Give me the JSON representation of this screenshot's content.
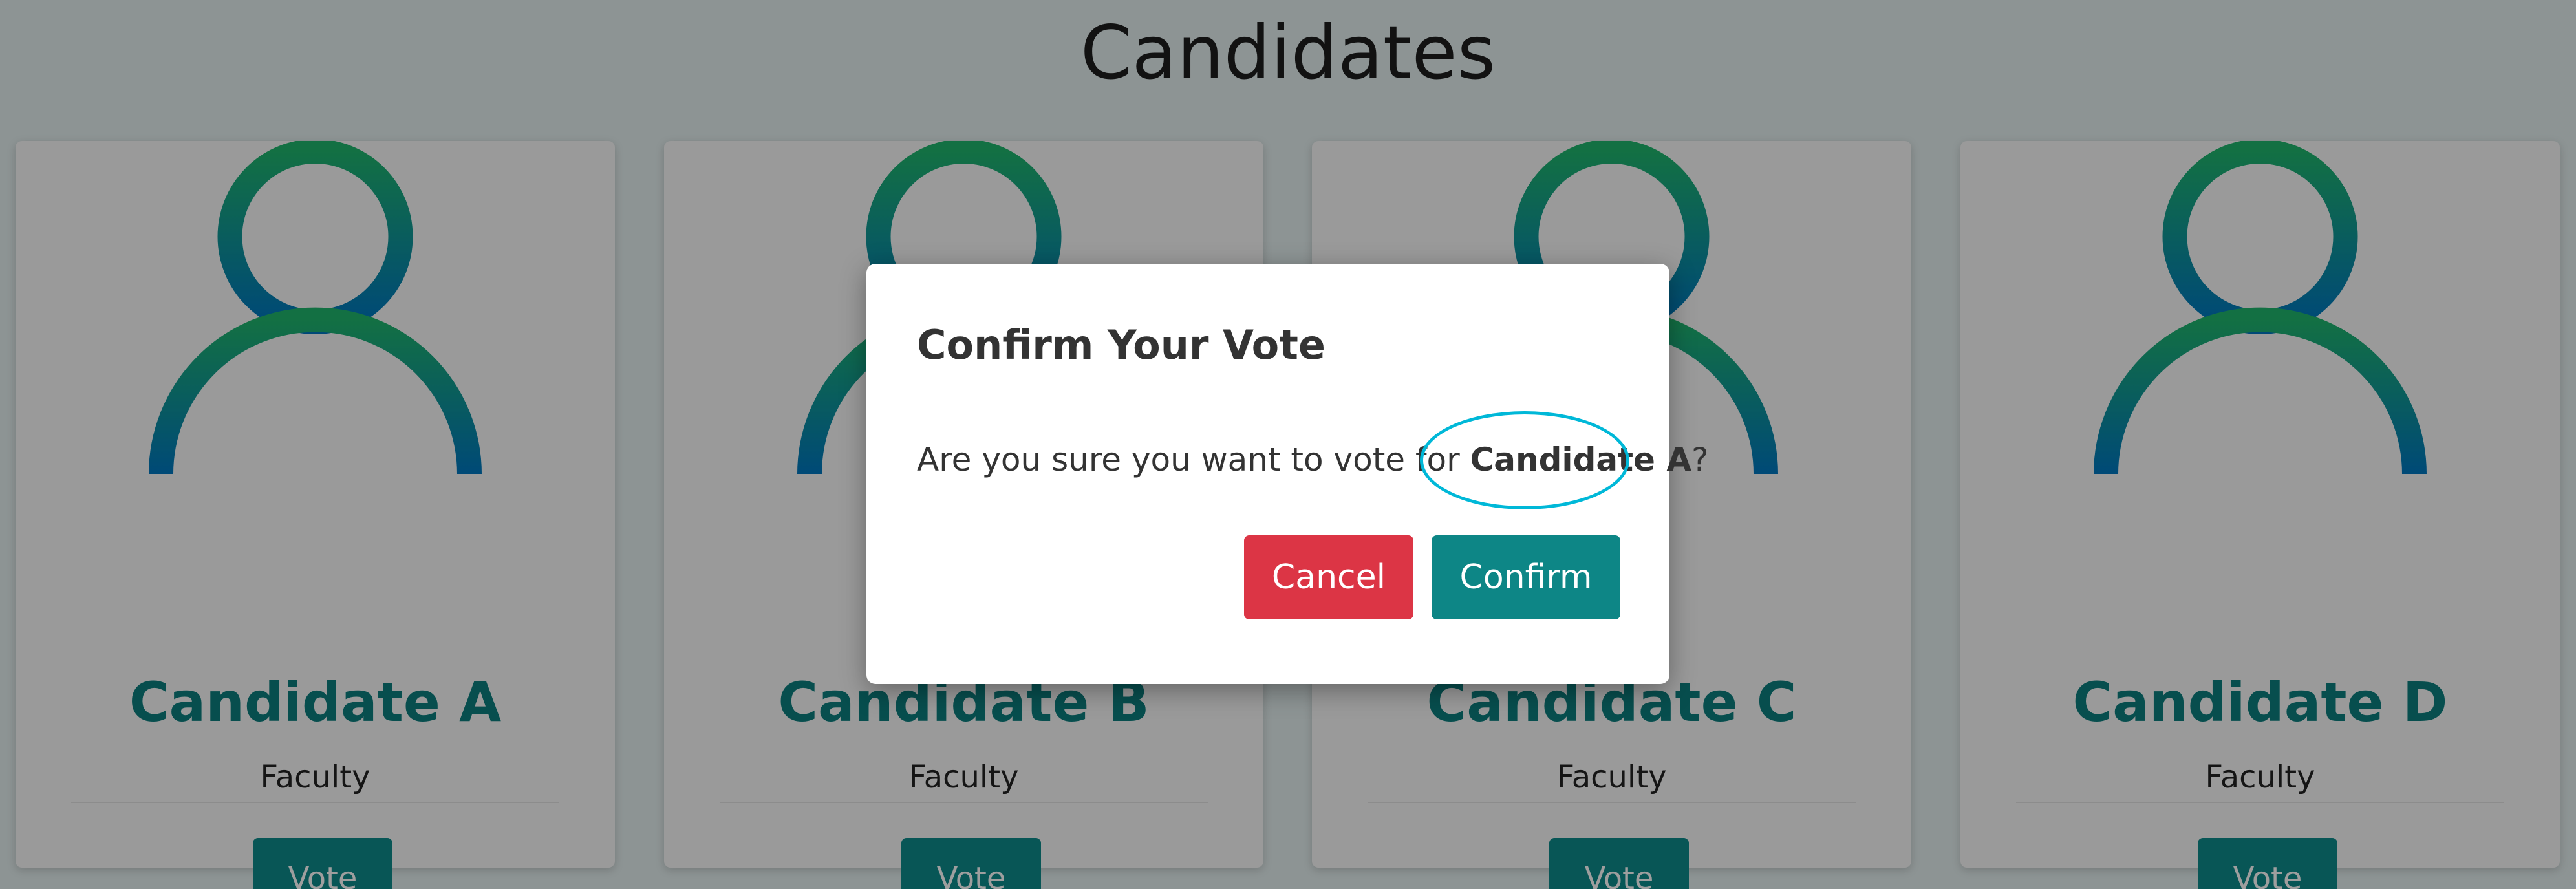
{
  "page": {
    "title": "Candidates"
  },
  "candidates": [
    {
      "name": "Candidate A",
      "role": "Faculty",
      "vote_label": "Vote"
    },
    {
      "name": "Candidate B",
      "role": "Faculty",
      "vote_label": "Vote"
    },
    {
      "name": "Candidate C",
      "role": "Faculty",
      "vote_label": "Vote"
    },
    {
      "name": "Candidate D",
      "role": "Faculty",
      "vote_label": "Vote"
    }
  ],
  "modal": {
    "title": "Confirm Your Vote",
    "message_prefix": "Are you sure you want to vote for",
    "candidate": "Candidate A",
    "message_suffix": "?",
    "cancel_label": "Cancel",
    "confirm_label": "Confirm"
  },
  "colors": {
    "avatar_gradient_top": "#1fb56d",
    "avatar_gradient_bottom": "#0077c0",
    "accent": "#0d8c8c",
    "danger": "#dc3545",
    "highlight": "#00b8d8"
  }
}
